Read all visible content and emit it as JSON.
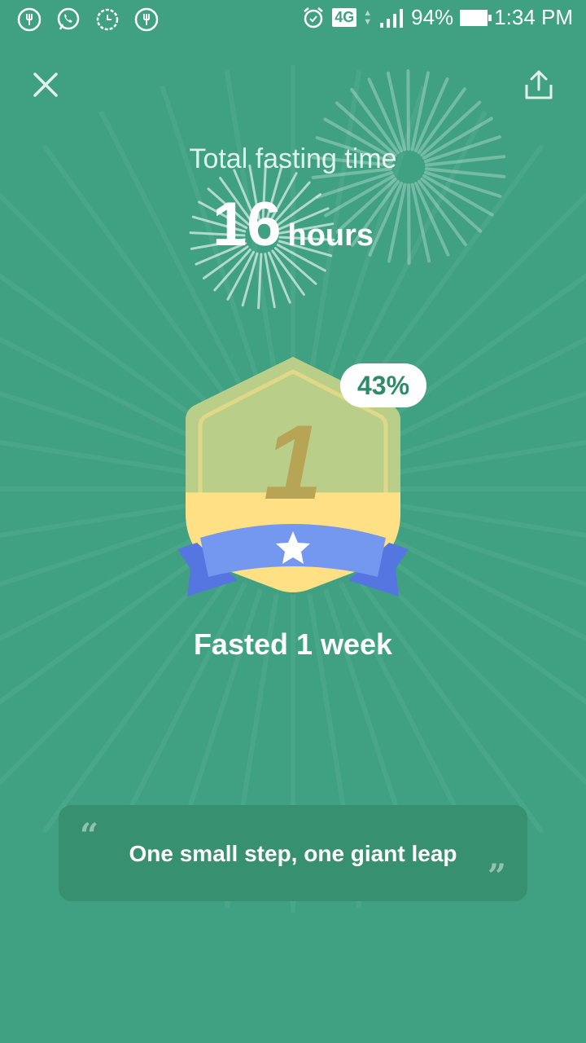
{
  "status_bar": {
    "network": "4G",
    "battery": "94%",
    "time": "1:34 PM"
  },
  "summary": {
    "label": "Total fasting time",
    "value": "16",
    "unit": "hours"
  },
  "achievement": {
    "badge_number": "1",
    "progress_percent": 43,
    "progress_label": "43%",
    "title": "Fasted 1 week"
  },
  "quote": {
    "open_mark": "“",
    "text": "One small step, one giant leap",
    "close_mark": "”"
  },
  "icons": {
    "close": "close-icon",
    "share": "share-icon"
  },
  "colors": {
    "background": "#3fa181",
    "badge_fill": "#ffe084",
    "badge_empty": "#b9cf89",
    "ribbon": "#7497f0",
    "ribbon_tail": "#5576e1",
    "card": "#37906f"
  }
}
